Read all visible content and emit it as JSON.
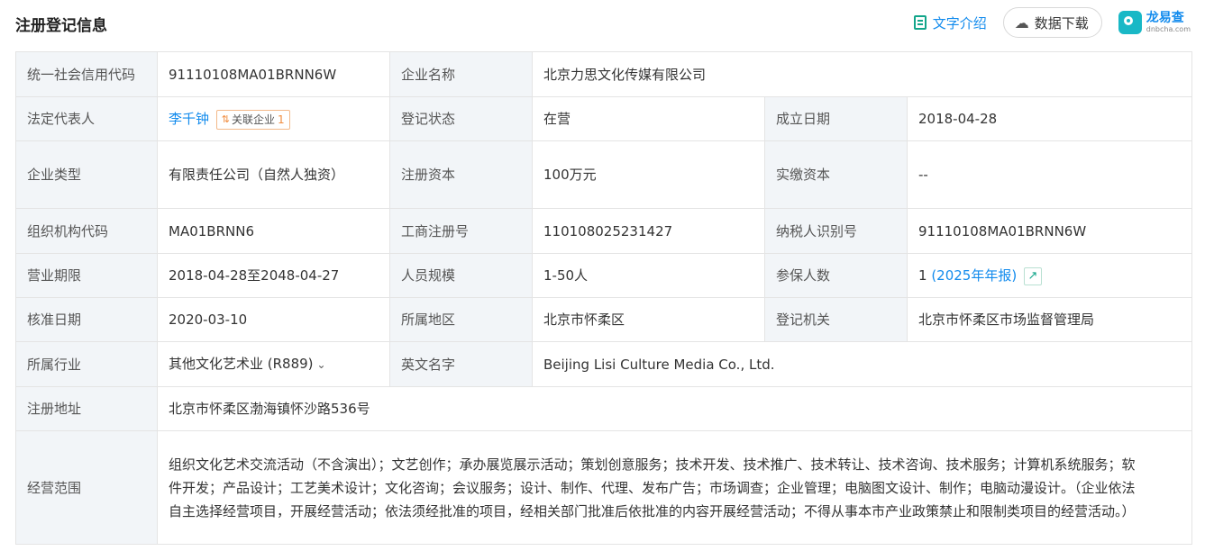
{
  "header": {
    "title": "注册登记信息",
    "text_intro_label": "文字介绍",
    "download_label": "数据下载",
    "brand_name": "龙易查",
    "brand_domain": "dnbcha.com"
  },
  "rows": {
    "credit_code": {
      "label": "统一社会信用代码",
      "value": "91110108MA01BRNN6W"
    },
    "company_name": {
      "label": "企业名称",
      "value": "北京力思文化传媒有限公司"
    },
    "legal_rep": {
      "label": "法定代表人",
      "value": "李千钟",
      "tag_label": "关联企业",
      "tag_count": "1"
    },
    "reg_status": {
      "label": "登记状态",
      "value": "在营"
    },
    "founded": {
      "label": "成立日期",
      "value": "2018-04-28"
    },
    "company_type": {
      "label": "企业类型",
      "value": "有限责任公司（自然人独资）"
    },
    "reg_capital": {
      "label": "注册资本",
      "value": "100万元"
    },
    "paid_capital": {
      "label": "实缴资本",
      "value": "--"
    },
    "org_code": {
      "label": "组织机构代码",
      "value": "MA01BRNN6"
    },
    "biz_reg_no": {
      "label": "工商注册号",
      "value": "110108025231427"
    },
    "taxpayer_id": {
      "label": "纳税人识别号",
      "value": "91110108MA01BRNN6W"
    },
    "biz_term": {
      "label": "营业期限",
      "value": "2018-04-28至2048-04-27"
    },
    "staff_size": {
      "label": "人员规模",
      "value": "1-50人"
    },
    "insured": {
      "label": "参保人数",
      "value": "1",
      "note": "(2025年年报)"
    },
    "approval_date": {
      "label": "核准日期",
      "value": "2020-03-10"
    },
    "region": {
      "label": "所属地区",
      "value": "北京市怀柔区"
    },
    "reg_authority": {
      "label": "登记机关",
      "value": "北京市怀柔区市场监督管理局"
    },
    "industry": {
      "label": "所属行业",
      "value": "其他文化艺术业 (R889)"
    },
    "english_name": {
      "label": "英文名字",
      "value": "Beijing Lisi Culture Media Co., Ltd."
    },
    "reg_address": {
      "label": "注册地址",
      "value": "北京市怀柔区渤海镇怀沙路536号"
    },
    "biz_scope": {
      "label": "经营范围",
      "value": "组织文化艺术交流活动（不含演出）；文艺创作；承办展览展示活动；策划创意服务；技术开发、技术推广、技术转让、技术咨询、技术服务；计算机系统服务；软件开发；产品设计；工艺美术设计；文化咨询；会议服务；设计、制作、代理、发布广告；市场调查；企业管理；电脑图文设计、制作；电脑动漫设计。（企业依法自主选择经营项目，开展经营活动；依法须经批准的项目，经相关部门批准后依批准的内容开展经营活动；不得从事本市产业政策禁止和限制类项目的经营活动。）"
    }
  }
}
